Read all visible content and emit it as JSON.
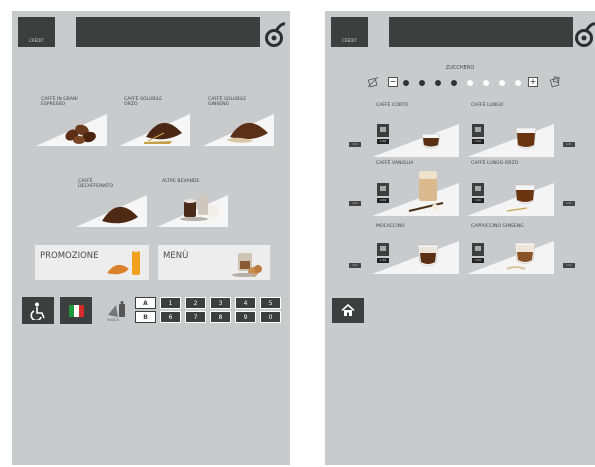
{
  "screen1": {
    "credit_label": "CRÉDIT",
    "products": [
      {
        "label": "CAFFÈ IN GRANI ESPRESSO"
      },
      {
        "label": "CAFFÈ SOLUBILE ORZO"
      },
      {
        "label": "CAFFÈ SOLUBILE GINSENG"
      },
      {
        "label": "CAFFÈ DECAFFEINATO"
      },
      {
        "label": "ALTRE BEVANDE"
      }
    ],
    "promo_label": "PROMOZIONE",
    "menu_label": "MENÙ",
    "accessibility_icon": "wheelchair-icon",
    "language_icon": "italian-flag-icon",
    "snack_label": "SNACK",
    "keypad": {
      "row_a": [
        "A",
        "1",
        "2",
        "3",
        "4",
        "5"
      ],
      "row_b": [
        "B",
        "6",
        "7",
        "8",
        "9",
        "0"
      ]
    }
  },
  "screen2": {
    "credit_label": "CRÉDIT",
    "sugar_title": "ZUCCHERO",
    "minus": "−",
    "plus": "+",
    "sugar_level_filled": 4,
    "sugar_level_total": 9,
    "drinks": [
      {
        "label": "CAFFÈ CORTO",
        "price": "0,60",
        "info": "info"
      },
      {
        "label": "CAFFÈ LUNGO",
        "price": "0,60",
        "info": "info"
      },
      {
        "label": "CAFFÈ VANIGLIA",
        "price": "0,60",
        "info": "info"
      },
      {
        "label": "CAFFÈ LUNGO ORZO",
        "price": "0,60",
        "info": "info"
      },
      {
        "label": "MOCACCINO",
        "price": "0,60",
        "info": "info"
      },
      {
        "label": "CAPPUCCINO GINSENG",
        "price": "0,60",
        "info": "info"
      }
    ],
    "home_icon": "home-icon"
  },
  "colors": {
    "screen_bg": "#c9cacc",
    "dark": "#3d3e3e",
    "panel": "#ededed"
  }
}
